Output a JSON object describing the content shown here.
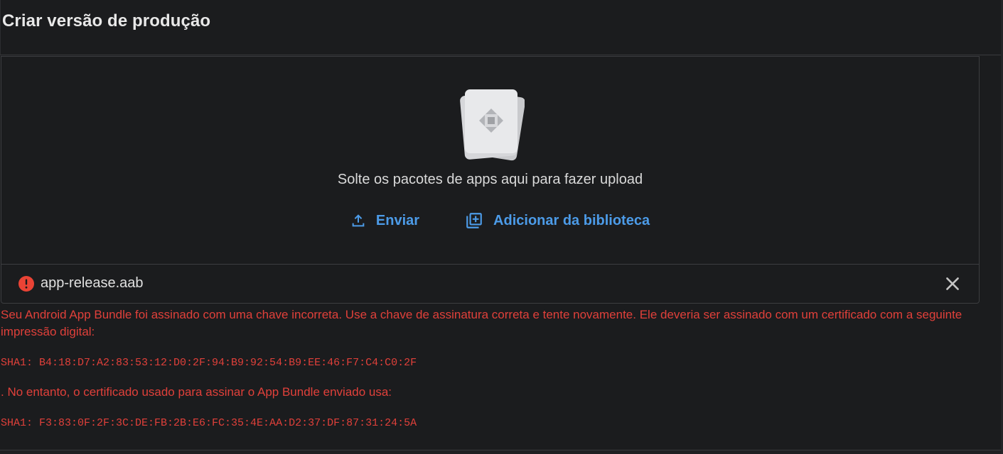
{
  "header": {
    "title": "Criar versão de produção"
  },
  "dropzone": {
    "illustration": "app-bundle-icon",
    "text": "Solte os pacotes de apps aqui para fazer upload",
    "actions": {
      "upload_label": "Enviar",
      "upload_icon": "upload-icon",
      "library_label": "Adicionar da biblioteca",
      "library_icon": "add-to-library-icon"
    }
  },
  "file": {
    "name": "app-release.aab",
    "status_icon": "error-icon",
    "remove_icon": "close-icon"
  },
  "error": {
    "message": "Seu Android App Bundle foi assinado com uma chave incorreta. Use a chave de assinatura correta e tente novamente. Ele deveria ser assinado com um certificado com a seguinte impressão digital:",
    "expected_hash": "SHA1: B4:18:D7:A2:83:53:12:D0:2F:94:B9:92:54:B9:EE:46:F7:C4:C0:2F",
    "message_2": ". No entanto, o certificado usado para assinar o App Bundle enviado usa:",
    "actual_hash": "SHA1: F3:83:0F:2F:3C:DE:FB:2B:E6:FC:35:4E:AA:D2:37:DF:87:31:24:5A"
  },
  "colors": {
    "background": "#1b1c1e",
    "accent": "#4c9be8",
    "error": "#e0403a",
    "text": "#e3e3e3"
  }
}
